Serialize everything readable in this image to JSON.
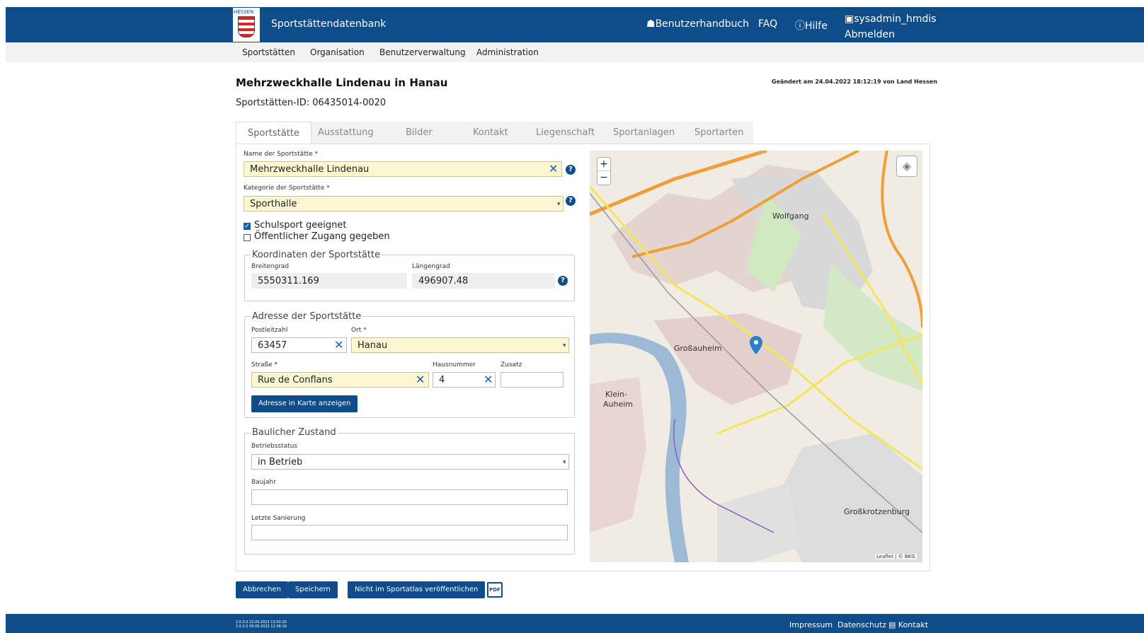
{
  "header": {
    "logo_text": "HESSEN",
    "brand": "Sportstättendatenbank",
    "manual": "Benutzerhandbuch",
    "faq": "FAQ",
    "help": "Hilfe",
    "user": "sysadmin_hmdis",
    "logout": "Abmelden"
  },
  "nav": [
    "Sportstätten",
    "Organisation",
    "Benutzerverwaltung",
    "Administration"
  ],
  "page": {
    "title": "Mehrzweckhalle Lindenau in Hanau",
    "changed": "Geändert am 24.04.2022 18:12:19 von Land Hessen",
    "id_label": "Sportstätten-ID: 06435014-0020"
  },
  "tabs": [
    "Sportstätte",
    "Ausstattung",
    "Bilder",
    "Kontakt",
    "Liegenschaft",
    "Sportanlagen",
    "Sportarten"
  ],
  "form": {
    "name_label": "Name der Sportstätte *",
    "name_value": "Mehrzweckhalle Lindenau",
    "category_label": "Kategorie der Sportstätte *",
    "category_value": "Sporthalle",
    "school_label": "Schulsport geeignet",
    "public_label": "Öffentlicher Zugang gegeben",
    "coords_legend": "Koordinaten der Sportstätte",
    "lat_label": "Breitengrad",
    "lat_value": "5550311.169",
    "lon_label": "Längengrad",
    "lon_value": "496907.48",
    "address_legend": "Adresse der Sportstätte",
    "zip_label": "Postleitzahl",
    "zip_value": "63457",
    "city_label": "Ort *",
    "city_value": "Hanau",
    "street_label": "Straße *",
    "street_value": "Rue de Conflans",
    "number_label": "Hausnummer",
    "number_value": "4",
    "extra_label": "Zusatz",
    "extra_value": "",
    "show_map_btn": "Adresse in Karte anzeigen",
    "condition_legend": "Baulicher Zustand",
    "status_label": "Betriebsstatus",
    "status_value": "in Betrieb",
    "year_label": "Baujahr",
    "year_value": "",
    "renov_label": "Letzte Sanierung",
    "renov_value": ""
  },
  "map": {
    "labels": [
      "Wolfgang",
      "Großauheim",
      "Klein-",
      "Auheim",
      "Großkrotzenburg"
    ],
    "attribution": "Leaflet | © BKG",
    "zoom_in": "+",
    "zoom_out": "−"
  },
  "actions": {
    "cancel": "Abbrechen",
    "save": "Speichern",
    "unpublish": "Nicht im Sportatlas veröffentlichen",
    "pdf": "PDF"
  },
  "footer": {
    "version1": "2.0.3.0 22.09.2022 13:50:26",
    "version2": "2.0.2.0 09.09.2022 12:38:18",
    "impressum": "Impressum",
    "privacy": "Datenschutz",
    "contact": "Kontakt"
  }
}
